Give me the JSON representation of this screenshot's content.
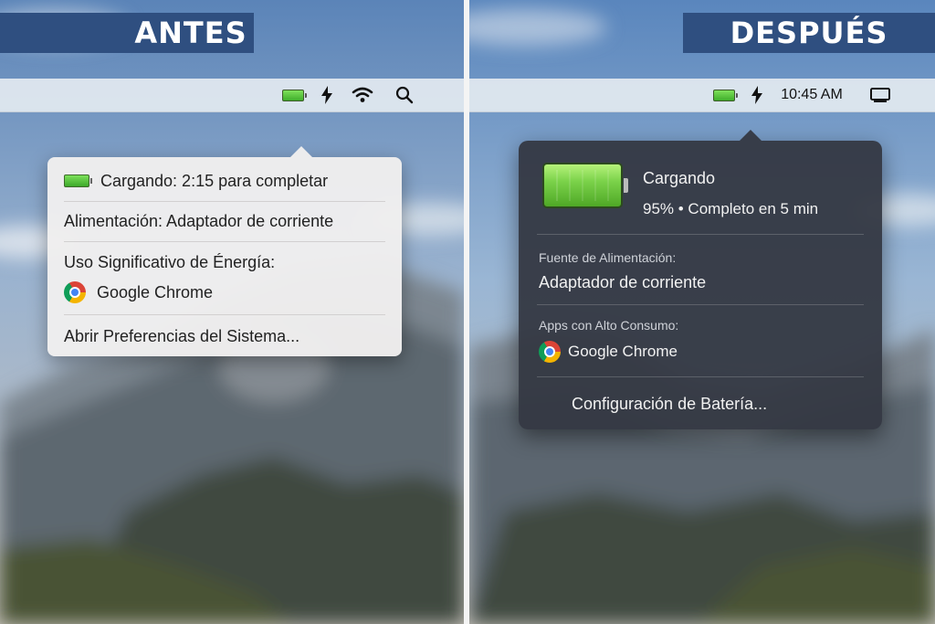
{
  "labels": {
    "before": "ANTES",
    "after": "DESPUÉS"
  },
  "menubar_before": {
    "icons": [
      "battery-icon",
      "bolt-icon",
      "wifi-icon",
      "search-icon"
    ]
  },
  "menubar_after": {
    "icons": [
      "battery-icon",
      "bolt-icon",
      "display-icon"
    ],
    "clock": "10:45 AM"
  },
  "popup_before": {
    "charging": "Cargando: 2:15 para completar",
    "power": "Alimentación: Adaptador de corriente",
    "energy_header": "Uso Significativo de Énergía:",
    "app": "Google Chrome",
    "prefs": "Abrir Preferencias del Sistema..."
  },
  "popup_after": {
    "status": "Cargando",
    "detail": "95% • Completo en 5 min",
    "power_header": "Fuente de Alimentación:",
    "power_value": "Adaptador de corriente",
    "apps_header": "Apps con Alto Consumo:",
    "app": "Google Chrome",
    "settings": "Configuración de Batería..."
  },
  "colors": {
    "banner": "#2f4f80",
    "battery_green": "#4fb82e",
    "popup_dark": "#343842"
  }
}
